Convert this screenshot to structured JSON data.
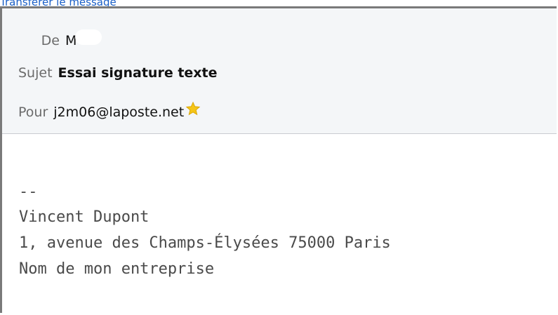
{
  "top_link": {
    "text": "Transférer le message"
  },
  "header": {
    "from": {
      "label": "De",
      "value": "M"
    },
    "subject": {
      "label": "Sujet",
      "value": "Essai signature texte"
    },
    "to": {
      "label": "Pour",
      "value": "j2m06@laposte.net",
      "icon": "star-icon"
    }
  },
  "body": {
    "signature_separator": "--",
    "signature_lines": [
      "Vincent Dupont",
      "1, avenue des Champs-Élysées 75000 Paris",
      "Nom de mon entreprise"
    ]
  },
  "colors": {
    "link": "#1a5fc7",
    "header_bg": "#f4f6f8",
    "star": "#f5c518"
  }
}
